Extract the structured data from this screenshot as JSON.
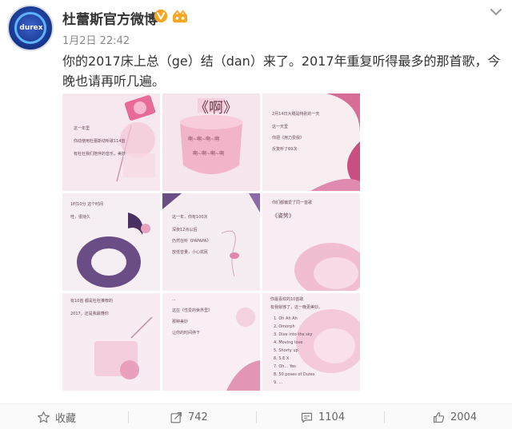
{
  "post": {
    "author": "杜蕾斯官方微博",
    "avatar_text": "durex",
    "time": "1月2日 22:42",
    "text": "你的2017床上总（ge）结（dan）来了。2017年重复听得最多的那首歌，今晚也请再听几遍。",
    "images": [
      {
        "id": "tile-1",
        "lines": [
          "这一年里",
          "你动使用杜蕾斯动听歌114首",
          "有杜杜我们陪伴的音乐，美妙"
        ]
      },
      {
        "id": "tile-2",
        "title": "《啊》",
        "lines": [
          "啊~啊~啊~啊",
          "啊~啊~啊~啊"
        ]
      },
      {
        "id": "tile-3",
        "lines": [
          "2月14日大概是特别的一天",
          "这一天里",
          "你把《用力爱我》",
          "反复听了69次"
        ]
      },
      {
        "id": "tile-4",
        "lines": [
          "1时10分 这个时间",
          "哇，很持久"
        ]
      },
      {
        "id": "tile-5",
        "lines": [
          "这一年，你有100次",
          "深夜12点以后",
          "仍然在听《PAPAPA》",
          "放低音量，小心扰民"
        ]
      },
      {
        "id": "tile-6",
        "lines": [
          "你们都偏爱了同一首歌",
          "《姿势》"
        ]
      },
      {
        "id": "tile-7",
        "lines": [
          "有10首 都是杜杜推荐的",
          "2017，还是我最懂你"
        ]
      },
      {
        "id": "tile-8",
        "lines": [
          "...",
          "这在《性爱的世界里》",
          "那种美妙",
          "让你的时间停下"
        ]
      },
      {
        "id": "tile-9",
        "lines": [
          "你最喜欢的10首歌",
          "有我就够了，这一晚更美妙。",
          "1. Oh Ah Ah",
          "2. Omorph",
          "3. Dive into the sky",
          "4. Moving love",
          "5. Shorty up",
          "6. S.E.X",
          "7. Oh... Yes",
          "8. 50 poses of Durex",
          "9. ..."
        ]
      }
    ],
    "actions": [
      {
        "id": "favorite",
        "icon": "star-icon",
        "label": "收藏"
      },
      {
        "id": "repost",
        "icon": "share-icon",
        "label": "742"
      },
      {
        "id": "comment",
        "icon": "comment-icon",
        "label": "1104"
      },
      {
        "id": "like",
        "icon": "thumbs-up-icon",
        "label": "2004"
      }
    ]
  },
  "colors": {
    "accent_pink": "#e8558a",
    "verified_orange": "#f5a623",
    "tile_bg": "#f7edf1"
  }
}
